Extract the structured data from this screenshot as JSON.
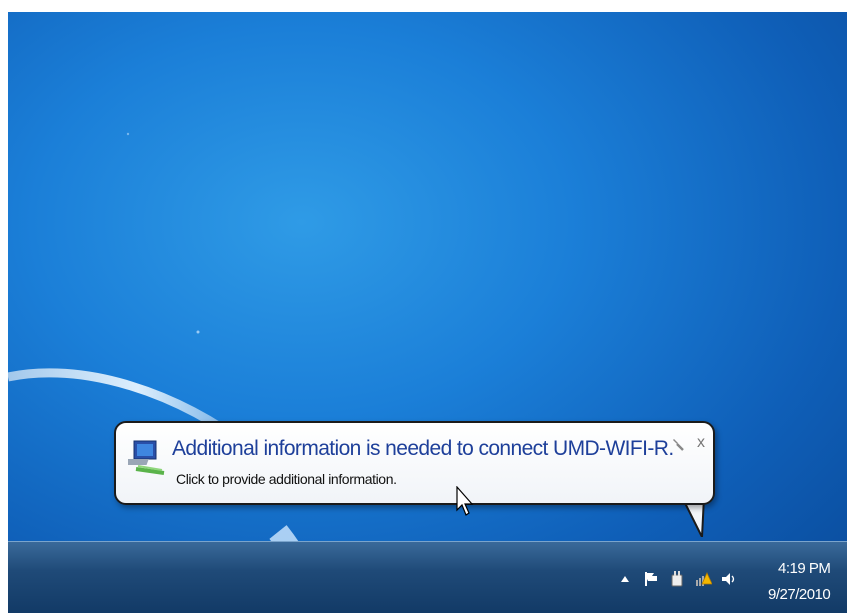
{
  "notification": {
    "title": "Additional information is needed to connect UMD-WIFI-R.",
    "body": "Click to provide additional information.",
    "close_label": "x",
    "icon": "network-warning-icon"
  },
  "tray": {
    "icons": [
      "show-hidden-icons-arrow",
      "action-center-flag-icon",
      "power-plug-icon",
      "network-warning-icon",
      "volume-icon"
    ]
  },
  "clock": {
    "time": "4:19 PM",
    "date": "9/27/2010"
  },
  "colors": {
    "desktop": "#1b7fd8",
    "balloon_title": "#1e3f9a"
  }
}
